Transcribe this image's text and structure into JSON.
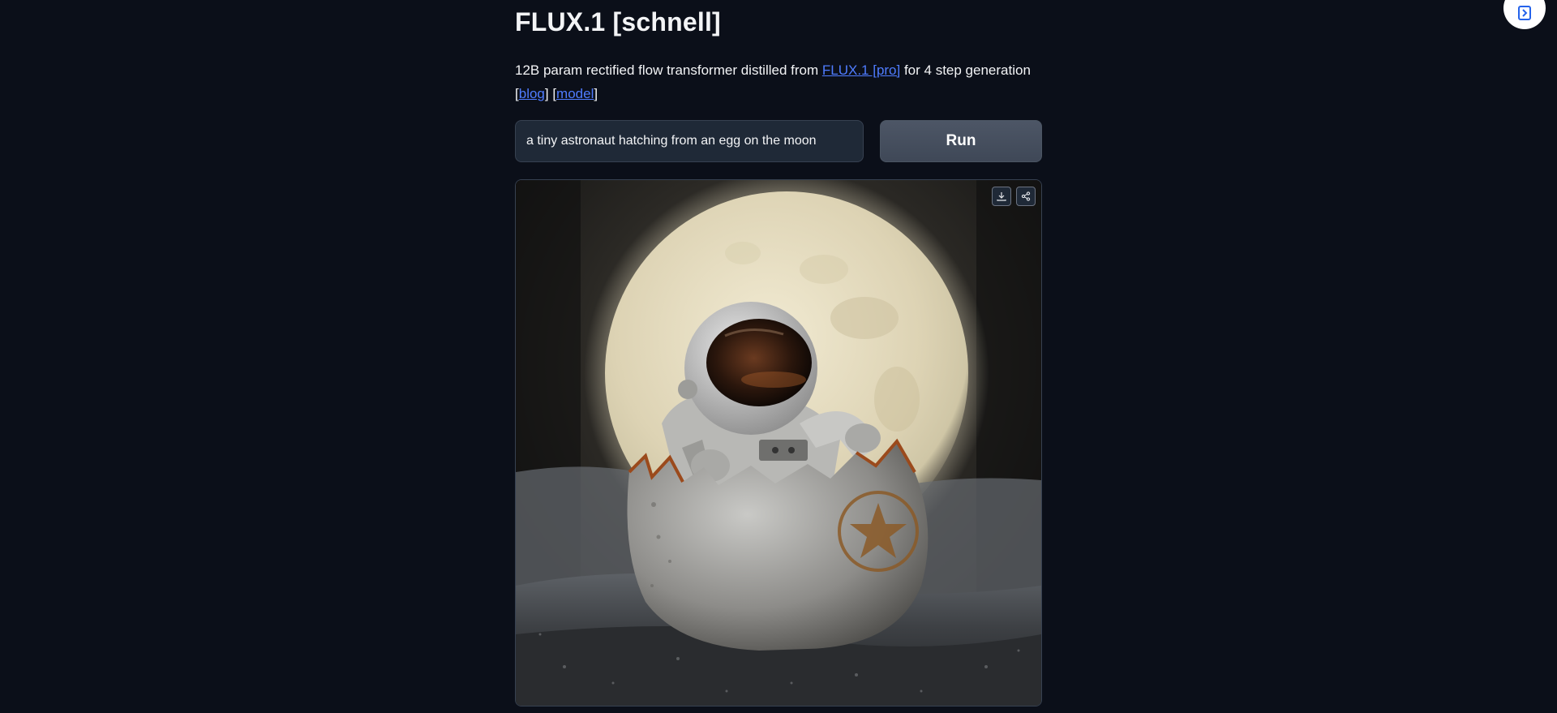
{
  "header": {
    "title": "FLUX.1 [schnell]"
  },
  "description": {
    "prefix": "12B param rectified flow transformer distilled from ",
    "link_pro": "FLUX.1 [pro]",
    "suffix": " for 4 step generation",
    "open1": "[",
    "link_blog": "blog",
    "mid": "] [",
    "link_model": "model",
    "close": "]"
  },
  "prompt": {
    "value": "a tiny astronaut hatching from an egg on the moon"
  },
  "run_button": {
    "label": "Run"
  },
  "result": {
    "download_icon": "download-icon",
    "share_icon": "share-icon"
  },
  "colors": {
    "background": "#0b0f19",
    "link": "#4f7cff",
    "input_bg": "#1f2937",
    "button_bg": "#4b5563"
  }
}
